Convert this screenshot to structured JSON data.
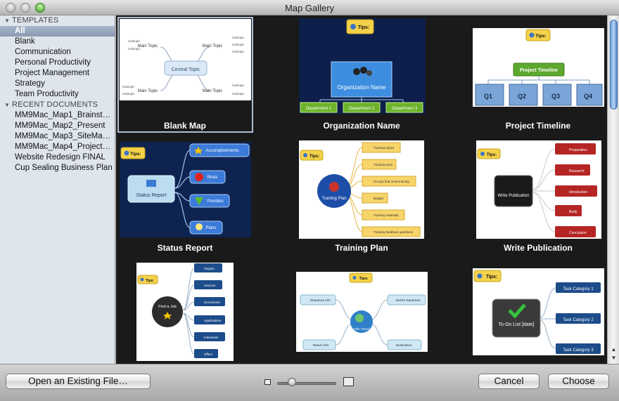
{
  "window": {
    "title": "Map Gallery"
  },
  "sidebar": {
    "templates_header": "TEMPLATES",
    "templates": [
      {
        "label": "All",
        "selected": true
      },
      {
        "label": "Blank"
      },
      {
        "label": "Communication"
      },
      {
        "label": "Personal Productivity"
      },
      {
        "label": "Project Management"
      },
      {
        "label": "Strategy"
      },
      {
        "label": "Team Productivity"
      }
    ],
    "recent_header": "RECENT DOCUMENTS",
    "recent": [
      {
        "label": "MM9Mac_Map1_Brainst…"
      },
      {
        "label": "MM9Mac_Map2_Present"
      },
      {
        "label": "MM9Mac_Map3_SiteMa…"
      },
      {
        "label": "MM9Mac_Map4_Project…"
      },
      {
        "label": "Website Redesign FINAL"
      },
      {
        "label": "Cup Sealing Business Plan"
      }
    ]
  },
  "gallery": {
    "items": [
      {
        "label": "Blank Map",
        "selected": true,
        "central": "Central Topic",
        "main": [
          "Main Topic",
          "Main Topic",
          "Main Topic",
          "Main Topic"
        ],
        "sub": "Subtopic"
      },
      {
        "label": "Organization Name",
        "tips": "Tips:",
        "central": "Organization Name",
        "depts": [
          "Department 1",
          "Department 2",
          "Department 3"
        ]
      },
      {
        "label": "Project Timeline",
        "tips": "Tips:",
        "central": "Project Timeline",
        "quarters": [
          "Q1",
          "Q2",
          "Q3",
          "Q4"
        ]
      },
      {
        "label": "Status Report",
        "tips": "Tips:",
        "central": "Status Report",
        "branches": [
          "Accomplishments",
          "Risks",
          "Priorities",
          "Plans"
        ]
      },
      {
        "label": "Training Plan",
        "tips": "Tips:",
        "central": "Training Plan",
        "branches": [
          "Training topics",
          "Training team",
          "Groups that need training",
          "Budget",
          "Training materials",
          "Training feedback questions"
        ]
      },
      {
        "label": "Write Publication",
        "tips": "Tips:",
        "central": "Write Publication",
        "branches": [
          "Preparation",
          "Research",
          "Introduction",
          "Body",
          "Conclusion"
        ]
      },
      {
        "tips": "Tips:",
        "central": "Find a Job",
        "branches": [
          "Targets",
          "Sources",
          "Documents",
          "Applications",
          "Interviews",
          "Offers"
        ]
      },
      {
        "tips": "Tips:",
        "central": "Plan Travel",
        "branches": [
          "Departure Info",
          "Before Departure",
          "Return Info",
          "Destination"
        ]
      },
      {
        "tips": "Tips:",
        "central": "To-Do List [date]",
        "branches": [
          "Task Category 1",
          "Task Category 2",
          "Task Category 3"
        ]
      }
    ]
  },
  "footer": {
    "open_button": "Open an Existing File…",
    "cancel_button": "Cancel",
    "choose_button": "Choose"
  },
  "colors": {
    "selection": "#aebfd6",
    "gallery_bg": "#1a1a1a",
    "sidebar_bg": "#dfe5ec"
  }
}
